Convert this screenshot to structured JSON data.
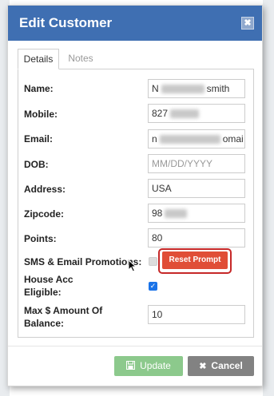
{
  "modal": {
    "title": "Edit Customer",
    "close_glyph": "✖"
  },
  "tabs": [
    {
      "label": "Details",
      "active": true
    },
    {
      "label": "Notes",
      "active": false
    }
  ],
  "fields": {
    "name": {
      "label": "Name:",
      "value_prefix": "N",
      "value_suffix": "smith"
    },
    "mobile": {
      "label": "Mobile:",
      "value_prefix": "827"
    },
    "email": {
      "label": "Email:",
      "value_prefix": "n",
      "value_suffix": "omai"
    },
    "dob": {
      "label": "DOB:",
      "placeholder": "MM/DD/YYYY"
    },
    "address": {
      "label": "Address:",
      "value": "USA"
    },
    "zipcode": {
      "label": "Zipcode:",
      "value_prefix": "98"
    },
    "points": {
      "label": "Points:",
      "value": "80"
    },
    "sms_email": {
      "label": "SMS & Email Promotions:",
      "checked": false,
      "disabled": true
    },
    "house_acc": {
      "label_line1": "House Acc",
      "label_line2": "Eligible:",
      "checked": true
    },
    "max_amount": {
      "label_line1": "Max $ Amount Of",
      "label_line2": "Balance:",
      "value": "10"
    }
  },
  "reset_prompt_label": "Reset Prompt",
  "footer": {
    "update_label": "Update",
    "cancel_label": "Cancel",
    "update_icon": "save-icon",
    "cancel_icon": "close-icon"
  },
  "colors": {
    "header": "#3f6fb2",
    "reset_button": "#e04e37",
    "highlight_ring": "#c62828",
    "update_button": "#8cc98c",
    "cancel_button": "#828282"
  }
}
